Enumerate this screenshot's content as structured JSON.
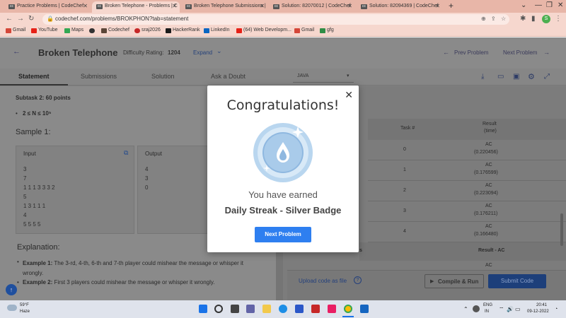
{
  "browser": {
    "tabs": [
      {
        "label": "Practice Problems | CodeChef",
        "active": false
      },
      {
        "label": "Broken Telephone - Problems | C",
        "active": true
      },
      {
        "label": "Broken Telephone Submissions |",
        "active": false
      },
      {
        "label": "Solution: 82070012 | CodeChef",
        "active": false
      },
      {
        "label": "Solution: 82094369 | CodeChef",
        "active": false
      }
    ],
    "new_tab": "+",
    "url": "codechef.com/problems/BROKPHON?tab=statement",
    "bookmarks": [
      "Gmail",
      "YouTube",
      "Maps",
      "",
      "Codechef",
      "sraj2026",
      "HackerRank",
      "LinkedIn",
      "(64) Web Developm...",
      "Gmail",
      "gfg"
    ],
    "profile_initial": "S"
  },
  "problem": {
    "title": "Broken Telephone",
    "difficulty_label": "Difficulty Rating:",
    "difficulty_value": "1204",
    "expand_label": "Expand",
    "prev_label": "Prev Problem",
    "next_label": "Next Problem",
    "tabs": [
      "Statement",
      "Submissions",
      "Solution",
      "Ask a Doubt"
    ],
    "language": "JAVA"
  },
  "statement": {
    "subtask": "Subtask 2: 60 points",
    "constraint": "2 ≤ N ≤ 10⁵",
    "sample_heading": "Sample 1:",
    "input_label": "Input",
    "output_label": "Output",
    "input_lines": [
      "3",
      "7",
      "1 1 1 3 3 3 2",
      "5",
      "1 3 1 1 1",
      "4",
      "5 5 5 5"
    ],
    "output_lines": [
      "4",
      "3",
      "0"
    ],
    "explanation_heading": "Explanation:",
    "example1_prefix": "Example 1:",
    "example1_text": "The 3-rd, 4-th, 6-th and 7-th player could mishear the message or whisper it wrongly.",
    "example2_prefix": "Example 2:",
    "example2_text": "First 3 players could mishear the message or whisper it wrongly."
  },
  "results": {
    "header_task": "Task #",
    "header_result": "Result",
    "header_time": "(time)",
    "rows": [
      {
        "task": "0",
        "verdict": "AC",
        "time": "(0.220456)"
      },
      {
        "task": "1",
        "verdict": "AC",
        "time": "(0.176599)"
      },
      {
        "task": "2",
        "verdict": "AC",
        "time": "(0.223094)"
      },
      {
        "task": "3",
        "verdict": "AC",
        "time": "(0.176211)"
      },
      {
        "task": "4",
        "verdict": "AC",
        "time": "(0.166480)"
      }
    ],
    "summary_prefix": "s",
    "summary_result": "Result - AC",
    "trailing_verdict": "AC",
    "upload_label": "Upload code as file",
    "compile_label": "Compile & Run",
    "submit_label": "Submit Code"
  },
  "modal": {
    "title": "Congratulations!",
    "earned_text": "You have earned",
    "badge_name": "Daily Streak - Silver Badge",
    "button_label": "Next Problem",
    "close_glyph": "✕"
  },
  "taskbar": {
    "weather_temp": "59°F",
    "weather_desc": "Haze",
    "lang_line1": "ENG",
    "lang_line2": "IN",
    "time": "20:41",
    "date": "09-12-2022"
  },
  "colors": {
    "accent": "#2e7ff0",
    "tabstrip": "#e8b6a8"
  }
}
